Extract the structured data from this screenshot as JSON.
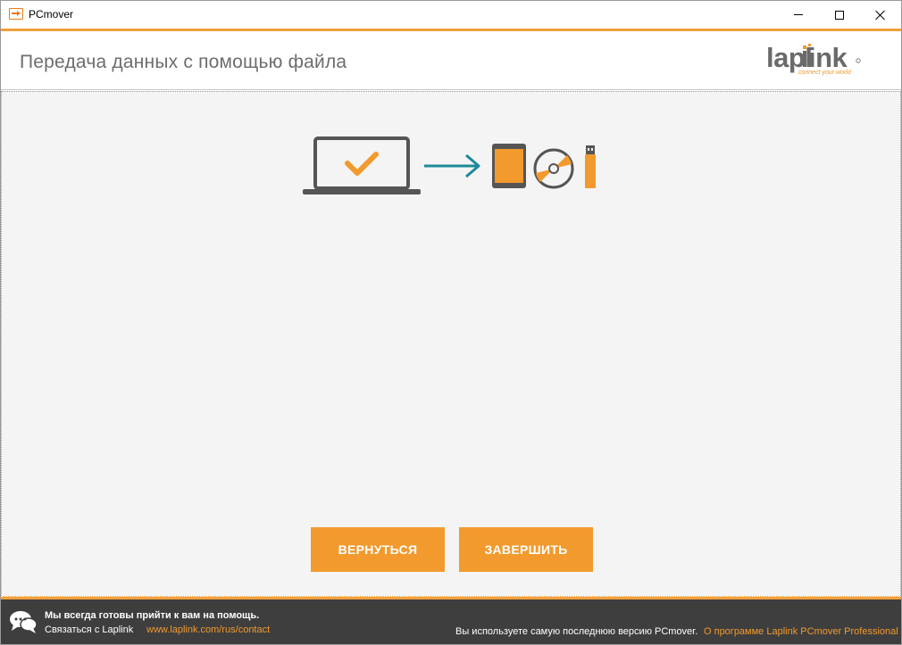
{
  "window": {
    "title": "PCmover"
  },
  "header": {
    "page_title": "Передача данных с помощью файла",
    "logo_word": "laplink",
    "logo_tagline": "connect your world"
  },
  "illustration": {
    "icons": [
      "laptop-check-icon",
      "arrow-right-icon",
      "tablet-icon",
      "disc-icon",
      "usb-drive-icon"
    ]
  },
  "actions": {
    "back_label": "ВЕРНУТЬСЯ",
    "finish_label": "ЗАВЕРШИТЬ"
  },
  "footer": {
    "help_title": "Мы всегда готовы прийти к вам на помощь.",
    "contact_label": "Связаться с Laplink",
    "contact_link": "www.laplink.com/rus/contact",
    "version_note": "Вы используете самую последнюю версию PCmover.",
    "about_link": "О программе Laplink PCmover Professional"
  },
  "colors": {
    "accent": "#f29a2e",
    "footer_bg": "#3e3e3e",
    "main_bg": "#f4f4f4",
    "teal_arrow": "#1d8a9a"
  }
}
